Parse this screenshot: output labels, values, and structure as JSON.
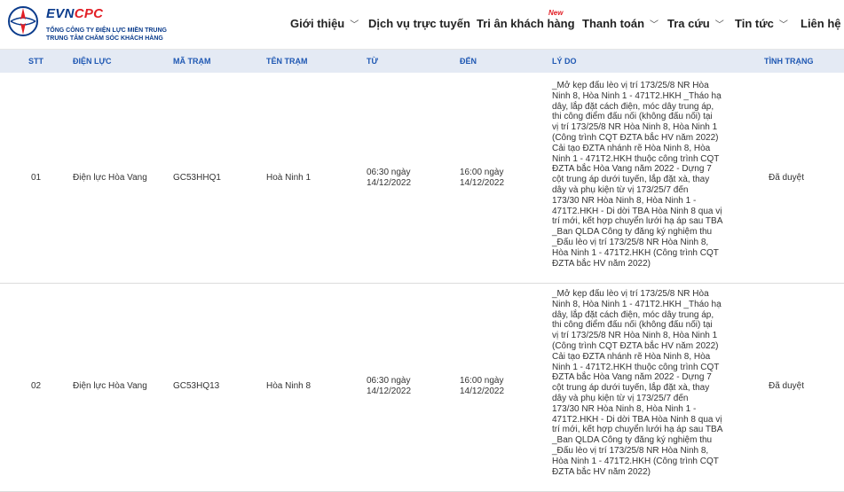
{
  "brand": {
    "name_a": "EVN",
    "name_b": "CPC",
    "line1": "TỔNG CÔNG TY ĐIỆN LỰC MIỀN TRUNG",
    "line2": "TRUNG TÂM CHĂM SÓC KHÁCH HÀNG",
    "colors": {
      "blue": "#0b3c8c",
      "red": "#e21f26"
    }
  },
  "nav": {
    "items": [
      {
        "label": "Giới thiệu",
        "has_dropdown": true
      },
      {
        "label": "Dịch vụ trực tuyến",
        "has_dropdown": false
      },
      {
        "label": "Tri ân khách hàng",
        "has_dropdown": false,
        "badge": "New"
      },
      {
        "label": "Thanh toán",
        "has_dropdown": true
      },
      {
        "label": "Tra cứu",
        "has_dropdown": true
      },
      {
        "label": "Tin tức",
        "has_dropdown": true
      },
      {
        "label": "Liên hệ",
        "has_dropdown": false
      }
    ],
    "dropdown_icon": "chevron-down-icon"
  },
  "table": {
    "header_color": "#1f58b3",
    "columns": [
      "STT",
      "ĐIỆN LỰC",
      "MÃ TRẠM",
      "TÊN TRẠM",
      "TỪ",
      "ĐẾN",
      "LÝ DO",
      "TÌNH TRẠNG"
    ],
    "rows": [
      {
        "stt": "01",
        "dien_luc": "Điện lực Hòa Vang",
        "ma_tram": "GC53HHQ1",
        "ten_tram": "Hoà Ninh 1",
        "tu_time": "06:30 ngày",
        "tu_date": "14/12/2022",
        "den_time": "16:00 ngày",
        "den_date": "14/12/2022",
        "ly_do": "_Mở kẹp đấu lèo vị trí 173/25/8 NR Hòa\nNinh 8, Hòa Ninh 1 - 471T2.HKH _Tháo hạ\ndây, lắp đặt cách điện, móc dây trung áp,\nthi công điểm đấu nối (không đấu nối) tại\nvị trí 173/25/8 NR Hòa Ninh 8, Hòa Ninh 1\n(Công trình CQT ĐZTA bắc HV năm 2022)\nCải tạo ĐZTA nhánh rẽ Hòa Ninh 8, Hòa\nNinh 1 - 471T2.HKH thuộc công trình CQT\nĐZTA bắc Hòa Vang năm 2022 - Dựng 7\ncột trung áp dưới tuyến, lắp đặt xà, thay\ndây và phụ kiện từ vị 173/25/7 đến\n173/30 NR Hòa Ninh 8, Hòa Ninh 1 -\n471T2.HKH - Di dời TBA Hòa Ninh 8 qua vị\ntrí mới, kết hợp chuyển lưới hạ áp sau TBA\n_Ban QLDA Công ty đăng ký nghiệm thu\n_Đấu lèo vị trí 173/25/8 NR Hòa Ninh 8,\nHòa Ninh 1 - 471T2.HKH (Công trình CQT\nĐZTA bắc HV năm 2022)",
        "tinh_trang": "Đã duyệt"
      },
      {
        "stt": "02",
        "dien_luc": "Điện lực Hòa Vang",
        "ma_tram": "GC53HQ13",
        "ten_tram": "Hòa Ninh 8",
        "tu_time": "06:30 ngày",
        "tu_date": "14/12/2022",
        "den_time": "16:00 ngày",
        "den_date": "14/12/2022",
        "ly_do": "_Mở kẹp đấu lèo vị trí 173/25/8 NR Hòa\nNinh 8, Hòa Ninh 1 - 471T2.HKH _Tháo hạ\ndây, lắp đặt cách điện, móc dây trung áp,\nthi công điểm đấu nối (không đấu nối) tại\nvị trí 173/25/8 NR Hòa Ninh 8, Hòa Ninh 1\n(Công trình CQT ĐZTA bắc HV năm 2022)\nCải tạo ĐZTA nhánh rẽ Hòa Ninh 8, Hòa\nNinh 1 - 471T2.HKH thuộc công trình CQT\nĐZTA bắc Hòa Vang năm 2022 - Dựng 7\ncột trung áp dưới tuyến, lắp đặt xà, thay\ndây và phụ kiện từ vị 173/25/7 đến\n173/30 NR Hòa Ninh 8, Hòa Ninh 1 -\n471T2.HKH - Di dời TBA Hòa Ninh 8 qua vị\ntrí mới, kết hợp chuyển lưới hạ áp sau TBA\n_Ban QLDA Công ty đăng ký nghiệm thu\n_Đấu lèo vị trí 173/25/8 NR Hòa Ninh 8,\nHòa Ninh 1 - 471T2.HKH (Công trình CQT\nĐZTA bắc HV năm 2022)",
        "tinh_trang": "Đã duyệt"
      }
    ]
  }
}
